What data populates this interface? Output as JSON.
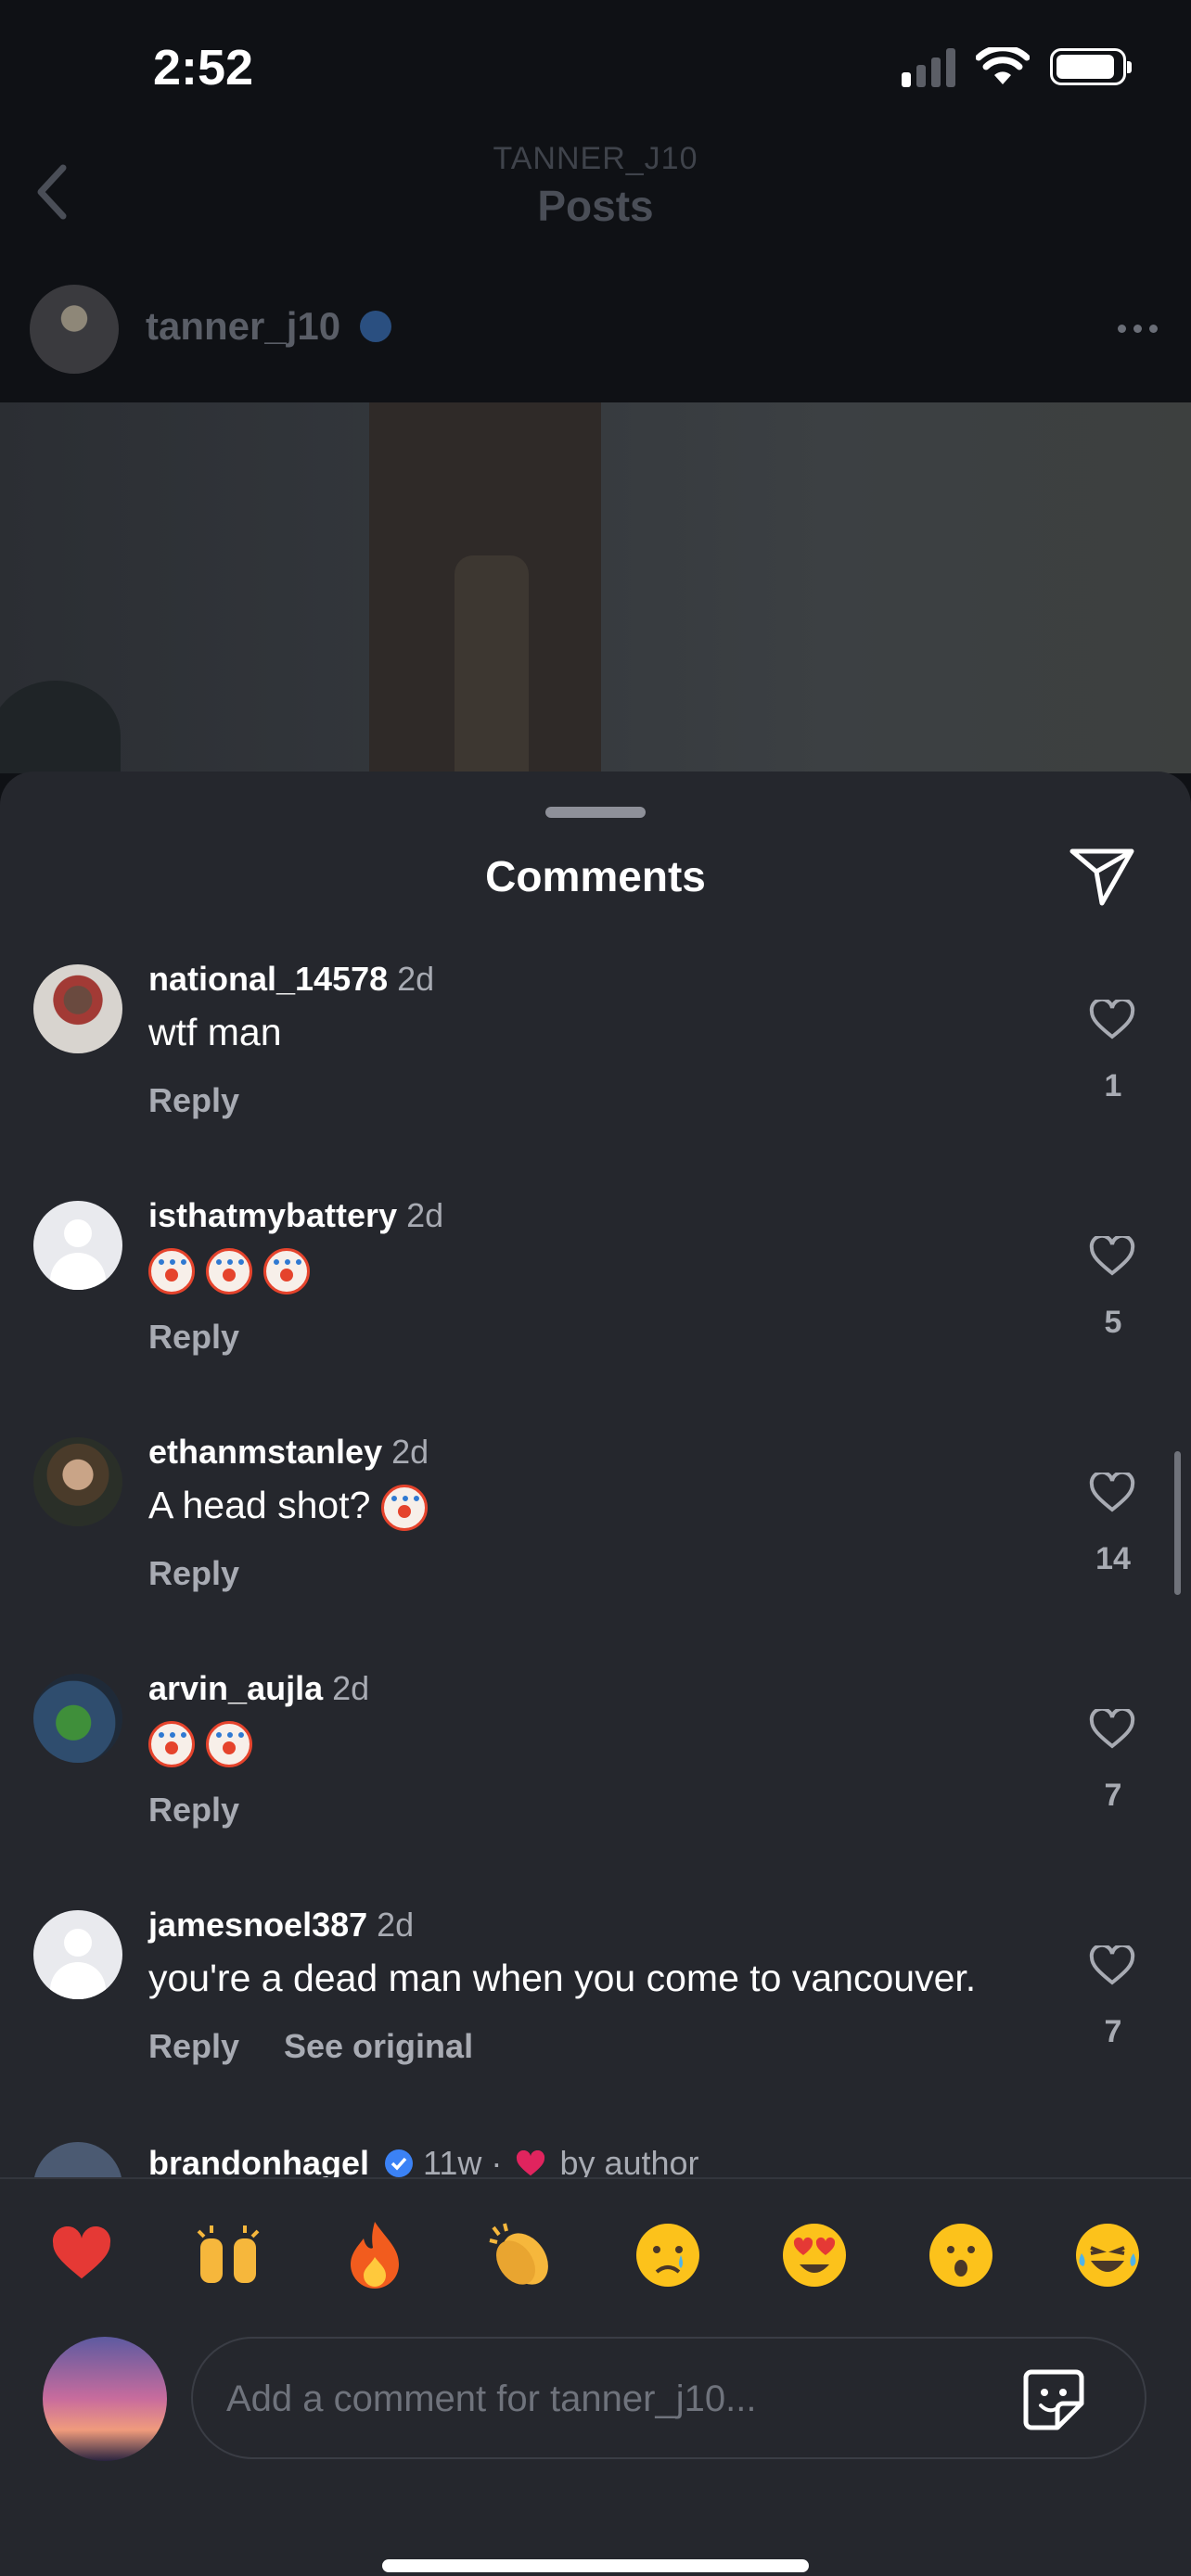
{
  "status_bar": {
    "time": "2:52"
  },
  "header": {
    "subtitle": "TANNER_J10",
    "title": "Posts"
  },
  "post": {
    "author": "tanner_j10"
  },
  "comments_sheet": {
    "title": "Comments",
    "comments": [
      {
        "username": "national_14578",
        "time": "2d",
        "text": "wtf man",
        "reply": "Reply",
        "likes": "1"
      },
      {
        "username": "isthatmybattery",
        "time": "2d",
        "text": "",
        "reply": "Reply",
        "likes": "5"
      },
      {
        "username": "ethanmstanley",
        "time": "2d",
        "text": "A head shot?",
        "reply": "Reply",
        "likes": "14"
      },
      {
        "username": "arvin_aujla",
        "time": "2d",
        "text": "",
        "reply": "Reply",
        "likes": "7"
      },
      {
        "username": "jamesnoel387",
        "time": "2d",
        "text": "you're a dead man when you come to vancouver.",
        "reply": "Reply",
        "see_original": "See original",
        "likes": "7"
      }
    ],
    "partial_comment": {
      "username": "brandonhagel",
      "meta": "11w ·",
      "liked_by": "by author"
    }
  },
  "emoji_bar": [
    "heart",
    "raised-hands",
    "fire",
    "clapping-hands",
    "crying-face",
    "heart-eyes",
    "surprised-face",
    "laughing-face"
  ],
  "composer": {
    "placeholder": "Add a comment for tanner_j10..."
  },
  "colors": {
    "sheet_bg": "#25272d",
    "secondary_text": "#a8abb3",
    "verified_blue": "#3b82f6",
    "heart_red": "#e0245e"
  }
}
